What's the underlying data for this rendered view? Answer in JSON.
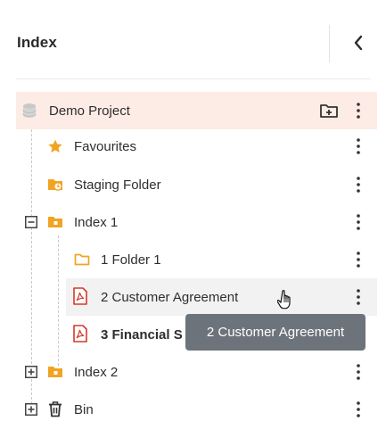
{
  "header": {
    "title": "Index"
  },
  "tree": {
    "root": {
      "label": "Demo Project"
    },
    "items": [
      {
        "label": "Favourites"
      },
      {
        "label": "Staging Folder"
      },
      {
        "label": "Index 1"
      },
      {
        "label": "1 Folder 1"
      },
      {
        "label": "2 Customer Agreement"
      },
      {
        "label": "3 Financial S"
      },
      {
        "label": "Index 2"
      },
      {
        "label": "Bin"
      }
    ]
  },
  "tooltip": {
    "text": "2 Customer Agreement"
  },
  "colors": {
    "accent_orange": "#f0a424",
    "pdf_red": "#d33a2c",
    "root_highlight": "#fdece5",
    "tooltip_bg": "#6d737a",
    "icon_grey": "#555555"
  }
}
